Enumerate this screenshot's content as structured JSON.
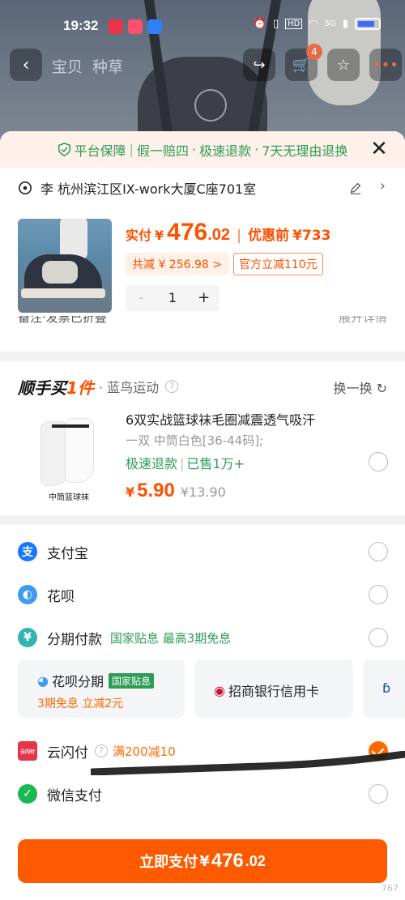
{
  "status_bar": {
    "time": "19:32",
    "network": "5G"
  },
  "nav": {
    "tabs": [
      "宝贝",
      "种草"
    ],
    "cart_count": "4"
  },
  "guarantee": {
    "label": "平台保障",
    "items": [
      "假一赔四",
      "极速退款",
      "7天无理由退换"
    ]
  },
  "address": {
    "text": "李 杭州滨江区IX-work大厦C座701室"
  },
  "order": {
    "pay_label": "实付",
    "currency": "¥",
    "price_int": "476",
    "price_dec": ".02",
    "before_label": "优惠前",
    "before_price": "¥733",
    "total_saved": "共减 ¥ 256.98 >",
    "official_discount": "官方立减110元",
    "quantity": "1",
    "minus": "-",
    "plus": "+",
    "remarks_label": "备注·发票已折叠",
    "remarks_expand": "展开详情"
  },
  "add_on": {
    "logo": "顺手买1件",
    "logo_accent": "1件",
    "store": "· 蓝鸟运动",
    "swap_label": "换一换",
    "image_caption": "中筒篮球袜",
    "title": "6双实战篮球袜毛圈减震透气吸汗",
    "spec": "一双 中筒白色[36-44码];",
    "fast_refund": "极速退款",
    "sold": "已售1万+",
    "price_yen": "¥",
    "price": "5.90",
    "original_price": "¥13.90"
  },
  "payments": {
    "alipay": "支付宝",
    "huabei": "花呗",
    "installments": "分期付款",
    "installments_note": "国家贴息 最高3期免息",
    "cards": [
      {
        "title": "花呗分期",
        "badge": "国家贴息",
        "sub": "3期免息   立减2元"
      },
      {
        "title": "招商银行信用卡"
      }
    ],
    "unionpay": "云闪付",
    "unionpay_icon_label": "云闪付",
    "unionpay_promo": "满200减10",
    "wechat": "微信支付"
  },
  "pay_button": {
    "label": "立即支付",
    "currency": "¥",
    "price_int": "476",
    "price_dec": ".02"
  },
  "corner_text": "767"
}
